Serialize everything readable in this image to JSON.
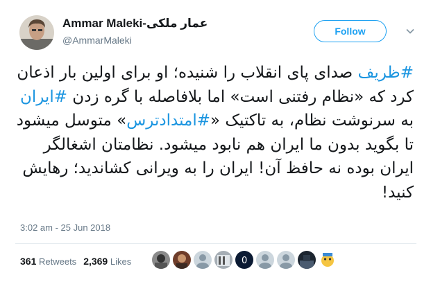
{
  "author": {
    "name": "Ammar Maleki-عمار ملکی",
    "handle": "@AmmarMaleki",
    "avatar_icon": "user-avatar-photo"
  },
  "follow_label": "Follow",
  "tweet": {
    "segments": [
      {
        "text": "#ظریف",
        "hashtag": true
      },
      {
        "text": " صدای پای انقلاب را شنیده؛ او برای اولین بار اذعان کرد که «نظام رفتنی است» اما بلافاصله با گره زدن ",
        "hashtag": false
      },
      {
        "text": "#ایران",
        "hashtag": true
      },
      {
        "text": " به سرنوشت نظام، به تاکتیک «",
        "hashtag": false
      },
      {
        "text": "#امتدادترس",
        "hashtag": true
      },
      {
        "text": "» متوسل میشود تا بگوید بدون ما ایران هم نابود میشود. نظامتان اشغالگر ایران بوده نه حافظ آن! ایران را به ویرانی کشاندید؛ رهایش کنید!",
        "hashtag": false
      }
    ]
  },
  "timestamp": "3:02 am - 25 Jun 2018",
  "stats": {
    "retweets_count": "361",
    "retweets_label": "Retweets",
    "likes_count": "2,369",
    "likes_label": "Likes"
  },
  "colors": {
    "accent": "#1da1f2",
    "hashtag": "#1b95e0",
    "secondary_text": "#657786"
  },
  "liker_avatars": [
    "avatar-1",
    "avatar-2",
    "avatar-3",
    "avatar-4",
    "avatar-5",
    "avatar-6",
    "avatar-7",
    "avatar-8",
    "avatar-9",
    "avatar-10"
  ]
}
